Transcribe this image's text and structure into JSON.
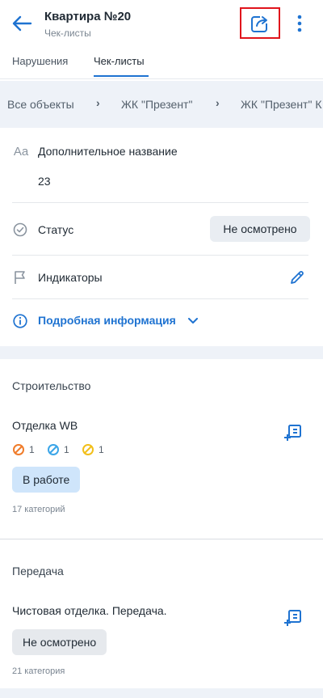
{
  "header": {
    "title": "Квартира №20",
    "subtitle": "Чек-листы",
    "back_icon": "arrow-left-icon",
    "share_icon": "share-icon",
    "more_icon": "more-vertical-icon"
  },
  "tabs": [
    {
      "label": "Нарушения",
      "active": false
    },
    {
      "label": "Чек-листы",
      "active": true
    }
  ],
  "breadcrumb": [
    "Все объекты",
    "ЖК \"Презент\"",
    "ЖК \"Презент\" К"
  ],
  "info": {
    "extra_name_label": "Дополнительное название",
    "extra_name_value": "23",
    "status_label": "Статус",
    "status_value": "Не осмотрено",
    "indicators_label": "Индикаторы",
    "details_label": "Подробная информация"
  },
  "sections": [
    {
      "title": "Строительство",
      "item": {
        "title": "Отделка WB",
        "indicators": [
          {
            "color": "#f07c2a",
            "count": "1"
          },
          {
            "color": "#3aa5e8",
            "count": "1"
          },
          {
            "color": "#f2bf1a",
            "count": "1"
          }
        ],
        "status": "В работе",
        "categories": "17 категорий"
      }
    },
    {
      "title": "Передача",
      "item": {
        "title": "Чистовая отделка. Передача.",
        "status": "Не осмотрено",
        "categories": "21 категория"
      }
    }
  ],
  "colors": {
    "accent": "#1f73d1",
    "highlight_border": "#e0141c",
    "breadcrumb_bg": "#eef2f8"
  }
}
